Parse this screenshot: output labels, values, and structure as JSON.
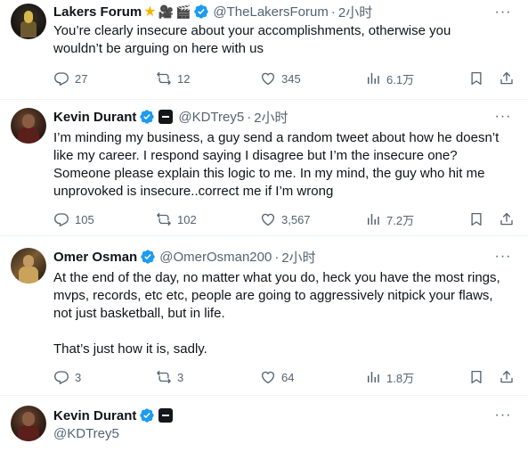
{
  "tweets": [
    {
      "name": "Lakers Forum",
      "badges": [
        "star-icon",
        "camera-icon",
        "clapper-icon",
        "verified-icon"
      ],
      "handle": "@TheLakersForum",
      "time": "2小时",
      "text": "You’re clearly insecure about your accomplishments, otherwise you\nwouldn’t be arguing on here with us",
      "replies": "27",
      "retweets": "12",
      "likes": "345",
      "views": "6.1万"
    },
    {
      "name": "Kevin Durant",
      "badges": [
        "verified-icon",
        "affiliation-icon"
      ],
      "handle": "@KDTrey5",
      "time": "2小时",
      "text": "I’m minding my business, a guy send a random tweet about how he doesn’t\nlike my career. I respond saying I disagree but I’m the insecure one?\nSomeone please explain this logic to me. In my mind, the guy who hit me\nunprovoked is insecure..correct me if I’m wrong",
      "replies": "105",
      "retweets": "102",
      "likes": "3,567",
      "views": "7.2万"
    },
    {
      "name": "Omer Osman",
      "badges": [
        "verified-icon"
      ],
      "handle": "@OmerOsman200",
      "time": "2小时",
      "text": "At the end of the day, no matter what you do, heck you have the most rings,\nmvps, records, etc etc, people are going to aggressively nitpick your flaws,\nnot just basketball, but in life.\n\nThat’s just how it is, sadly.",
      "replies": "3",
      "retweets": "3",
      "likes": "64",
      "views": "1.8万"
    },
    {
      "name": "Kevin Durant",
      "badges": [
        "verified-icon",
        "affiliation-icon"
      ],
      "handle": "@KDTrey5"
    }
  ],
  "ui": {
    "dot": "·",
    "more": "···"
  },
  "colors": {
    "verified": "#1d9bf0",
    "secondary_text": "#536471",
    "divider": "#eff3f4"
  }
}
